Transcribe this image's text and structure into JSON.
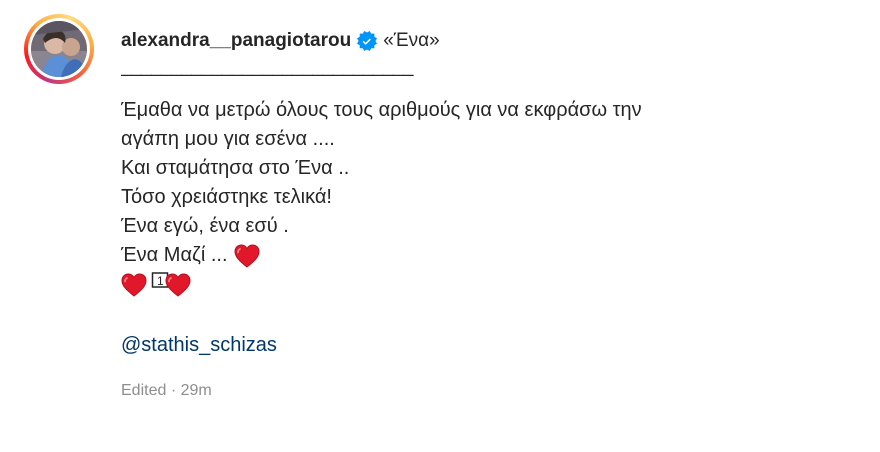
{
  "post": {
    "username": "alexandra__panagiotarou",
    "verified_icon": "verified-badge-icon",
    "title": "«Ένα»",
    "underline": "_____________________________",
    "lines": [
      "Έμαθα να μετρώ όλους τους αριθμούς για να εκφράσω την",
      "αγάπη μου για εσένα ....",
      "Και σταμάτησα στο Ένα ..",
      "Τόσο χρειάστηκε τελικά!",
      "Ένα εγώ, ένα εσύ .",
      "Ένα Μαζί ..."
    ],
    "emoji_line_symbol": "1",
    "mention": "@stathis_schizas",
    "edited_label": "Edited",
    "separator": "·",
    "time_ago": "29m"
  },
  "colors": {
    "text": "#262626",
    "link": "#00376b",
    "muted": "#8e8e8e",
    "verified": "#0095f6",
    "heart": "#e0182a"
  },
  "icons": {
    "heart": "red-heart-icon",
    "keycap": "keycap-one-icon"
  }
}
